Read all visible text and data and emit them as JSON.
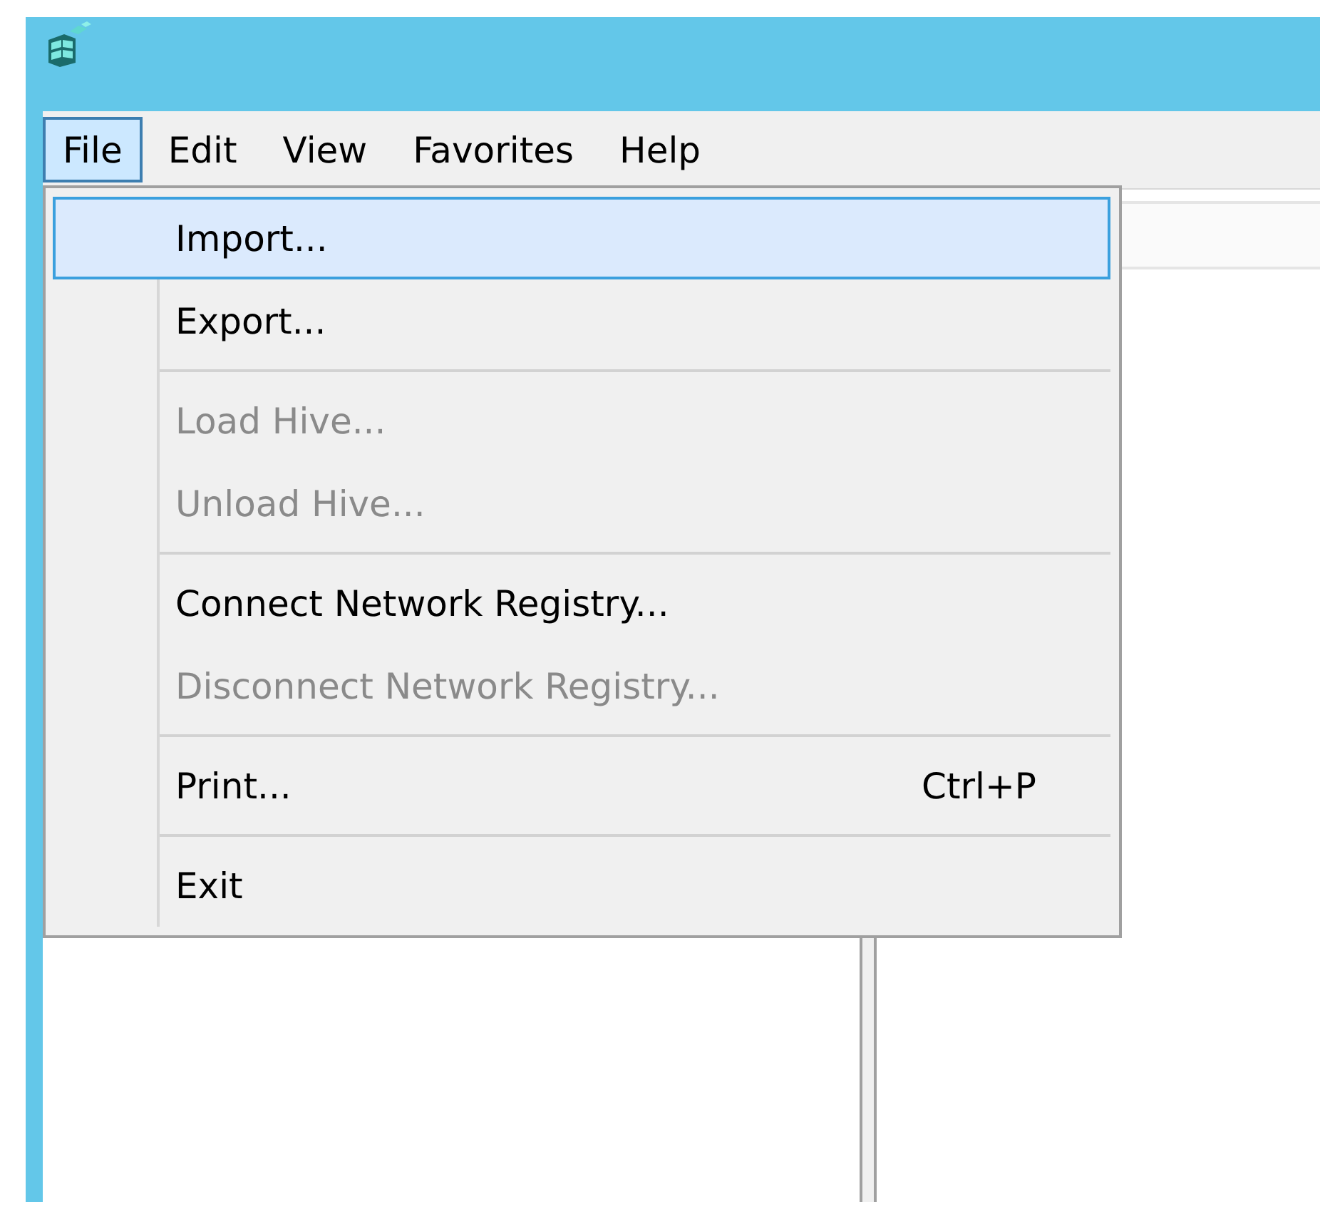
{
  "menubar": [
    {
      "label": "File",
      "selected": true
    },
    {
      "label": "Edit",
      "selected": false
    },
    {
      "label": "View",
      "selected": false
    },
    {
      "label": "Favorites",
      "selected": false
    },
    {
      "label": "Help",
      "selected": false
    }
  ],
  "menu": {
    "items": [
      {
        "kind": "item",
        "label": "Import...",
        "selected": true,
        "disabled": false
      },
      {
        "kind": "item",
        "label": "Export...",
        "selected": false,
        "disabled": false
      },
      {
        "kind": "separator"
      },
      {
        "kind": "item",
        "label": "Load Hive...",
        "selected": false,
        "disabled": true
      },
      {
        "kind": "item",
        "label": "Unload Hive...",
        "selected": false,
        "disabled": true
      },
      {
        "kind": "separator"
      },
      {
        "kind": "item",
        "label": "Connect Network Registry...",
        "selected": false,
        "disabled": false
      },
      {
        "kind": "item",
        "label": "Disconnect Network Registry...",
        "selected": false,
        "disabled": true
      },
      {
        "kind": "separator"
      },
      {
        "kind": "item",
        "label": "Print...",
        "shortcut": "Ctrl+P",
        "selected": false,
        "disabled": false
      },
      {
        "kind": "separator"
      },
      {
        "kind": "item",
        "label": "Exit",
        "selected": false,
        "disabled": false
      }
    ]
  }
}
